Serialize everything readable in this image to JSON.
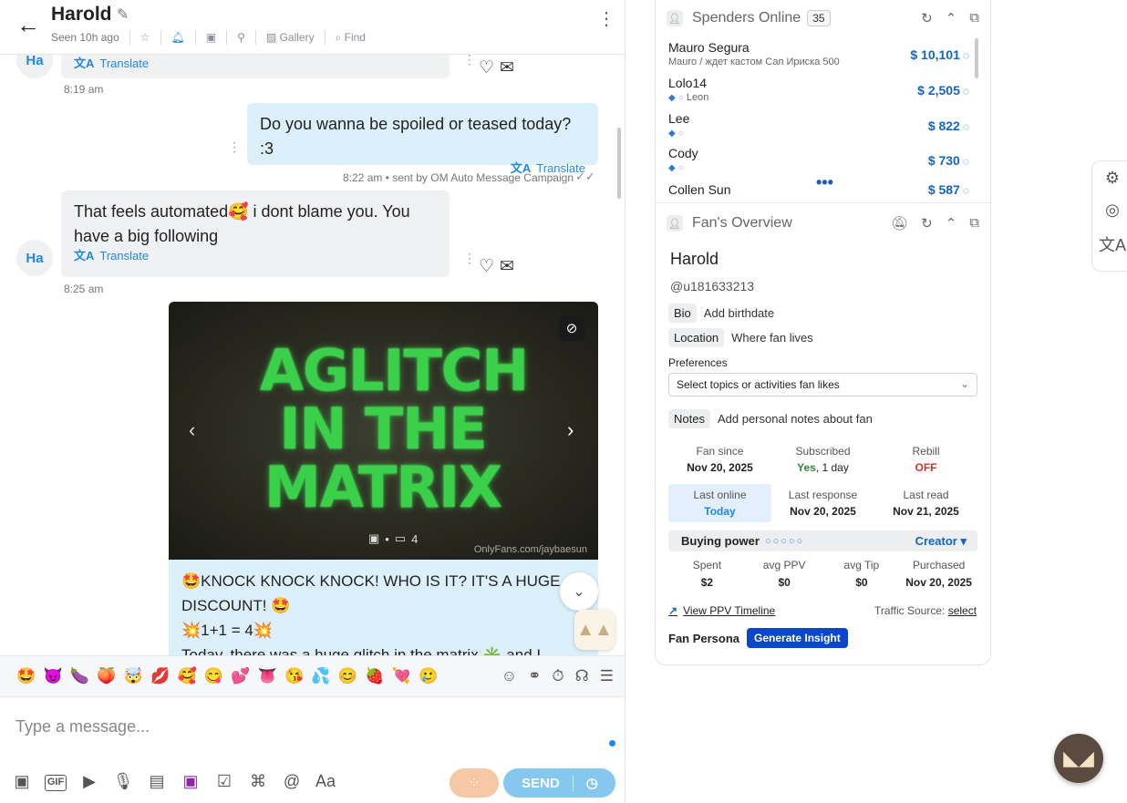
{
  "header": {
    "name": "Harold",
    "seen": "Seen 10h ago",
    "gallery": "Gallery",
    "find": "Find"
  },
  "messages": {
    "m1": {
      "avatar": "Ha",
      "translate": "Translate",
      "time": "8:19 am"
    },
    "m2": {
      "text": "Do you wanna be spoiled or teased today? :3",
      "translate": "Translate",
      "time": "8:22 am • sent by OM Auto Message Campaign"
    },
    "m3": {
      "avatar": "Ha",
      "text": "That feels automated🥰 i dont blame you. You have a big following",
      "translate": "Translate",
      "time": "8:25 am"
    },
    "media": {
      "title": "AGLITCH IN THE MATRIX",
      "count": "4",
      "watermark": "OnlyFans.com/jaybaesun"
    },
    "promo": {
      "line1": "🤩KNOCK KNOCK KNOCK! WHO IS IT? IT'S A HUGE DISCOUNT! 🤩",
      "line2": "💥1+1 = 4💥",
      "line3": "Today, there was a huge glitch in the matrix ✳️ and I"
    }
  },
  "emoji_bar": [
    "🤩",
    "😈",
    "🍆",
    "🍑",
    "🤯",
    "💋",
    "🥰",
    "😋",
    "💕",
    "👅",
    "😘",
    "💦",
    "😊",
    "🍓",
    "💘",
    "🥲"
  ],
  "composer": {
    "placeholder": "Type a message...",
    "send": "SEND"
  },
  "spenders": {
    "title": "Spenders Online",
    "count": "35",
    "rows": [
      {
        "name": "Mauro Segura",
        "sub": "Mauro / ждет кастом Сап Ириска 500",
        "amount": "$ 10,101"
      },
      {
        "name": "Lolo14",
        "sub": "Leon",
        "amount": "$ 2,505"
      },
      {
        "name": "Lee",
        "sub": "",
        "amount": "$ 822"
      },
      {
        "name": "Cody",
        "sub": "",
        "amount": "$ 730"
      },
      {
        "name": "Collen Sun",
        "sub": "",
        "amount": "$ 587"
      }
    ]
  },
  "overview": {
    "title": "Fan's Overview",
    "name": "Harold",
    "handle": "@u181633213",
    "bio_label": "Bio",
    "bio_value": "Add birthdate",
    "location_label": "Location",
    "location_value": "Where fan lives",
    "preferences_label": "Preferences",
    "preferences_select": "Select topics or activities fan likes",
    "notes_label": "Notes",
    "notes_value": "Add personal notes about fan",
    "stats1": [
      {
        "label": "Fan since",
        "value": "Nov 20, 2025"
      },
      {
        "label": "Subscribed",
        "value_a": "Yes",
        "value_b": ", 1 day"
      },
      {
        "label": "Rebill",
        "value": "OFF"
      }
    ],
    "stats2": [
      {
        "label": "Last online",
        "value": "Today"
      },
      {
        "label": "Last response",
        "value": "Nov 20, 2025"
      },
      {
        "label": "Last read",
        "value": "Nov 21, 2025"
      }
    ],
    "buying_power": "Buying power",
    "buying_power_level": 0,
    "tier": "Creator",
    "stats3": [
      {
        "label": "Spent",
        "value": "$2"
      },
      {
        "label": "avg PPV",
        "value": "$0"
      },
      {
        "label": "avg Tip",
        "value": "$0"
      },
      {
        "label": "Purchased",
        "value": "Nov 20, 2025"
      }
    ],
    "ppv_link": "View PPV Timeline",
    "traffic_label": "Traffic Source:",
    "traffic_value": "select",
    "persona_label": "Fan Persona",
    "generate": "Generate Insight"
  }
}
